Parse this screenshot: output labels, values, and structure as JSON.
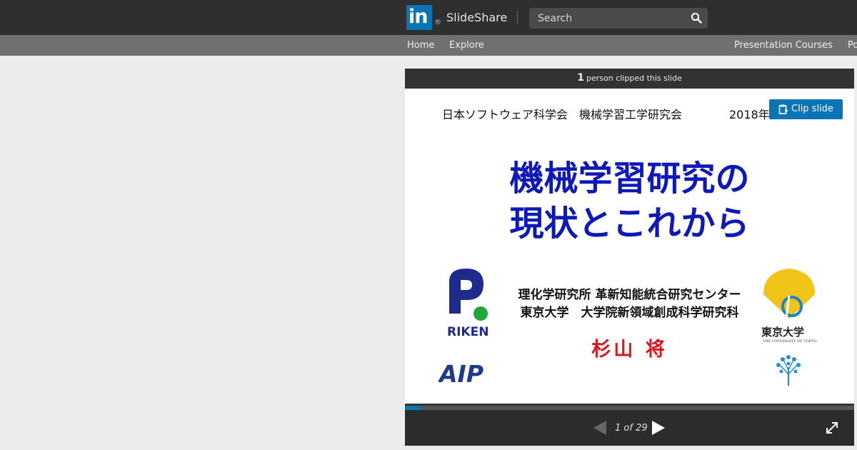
{
  "header": {
    "logo_text": "in",
    "registered": "®",
    "brand": "SlideShare",
    "search_placeholder": "Search"
  },
  "nav": {
    "items": [
      "Home",
      "Explore"
    ],
    "right_items": [
      "Presentation Courses",
      "Po"
    ]
  },
  "player": {
    "clip_count": "1",
    "clip_text": "person clipped this slide",
    "clip_button": "Clip slide",
    "page_indicator": "1 of 29",
    "progress": 0.0345,
    "accent_color": "#0a75b4"
  },
  "slide": {
    "header": "日本ソフトウェア科学会　機械学習工学研究会",
    "year": "2018年",
    "title_line1": "機械学習研究の",
    "title_line2": "現状とこれから",
    "affiliation_line1": "理化学研究所 革新知能統合研究センター",
    "affiliation_line2": "東京大学　大学院新領域創成科学研究科",
    "author": "杉山 将",
    "logo_riken": "RIKEN",
    "logo_aip": "AIP",
    "logo_utokyo": "東京大学",
    "logo_utokyo_sub": "THE UNIVERSITY OF TOKYO",
    "title_color": "#0f19b9",
    "author_color": "#e0141c"
  }
}
